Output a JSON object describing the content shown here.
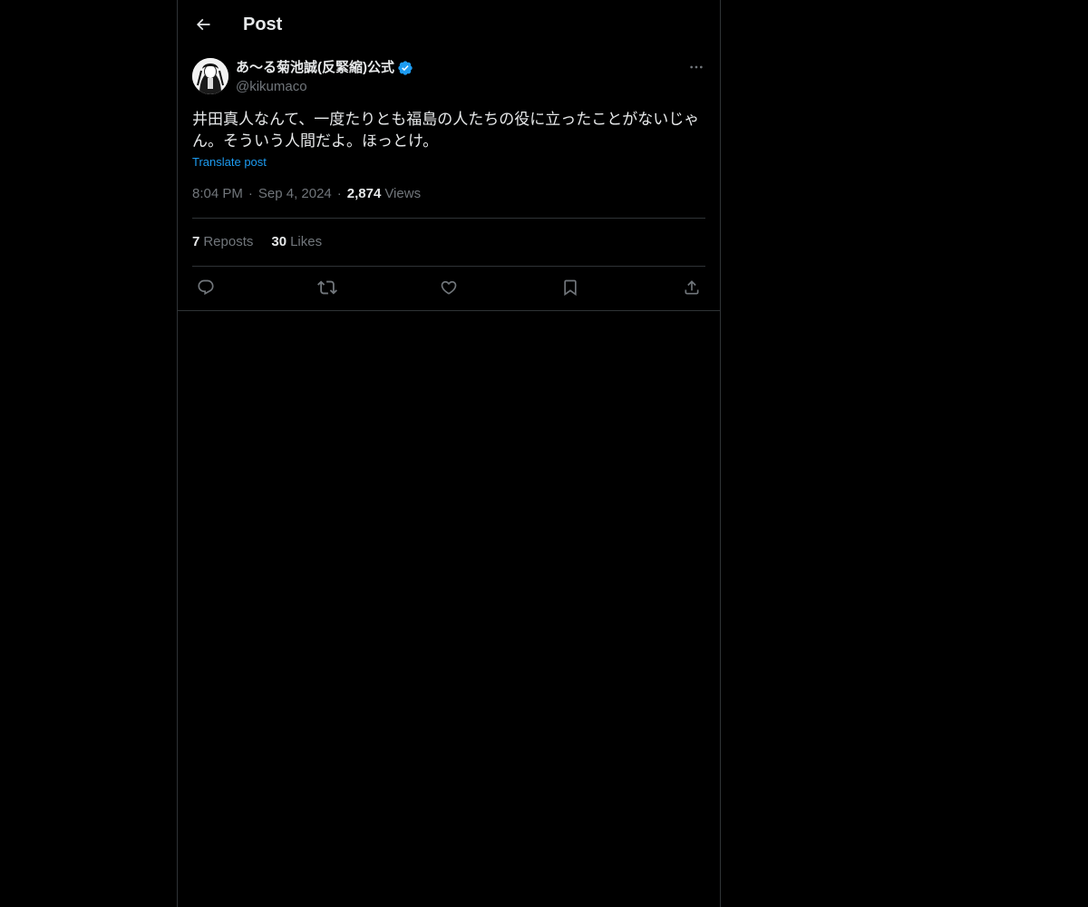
{
  "header": {
    "title": "Post",
    "back_icon": "arrow-left-icon"
  },
  "post": {
    "author": {
      "name": "あ〜る菊池誠(反緊縮)公式",
      "handle": "@kikumaco",
      "verified": true,
      "verified_color": "#1d9bf0"
    },
    "text": "井田真人なんて、一度たりとも福島の人たちの役に立ったことがないじゃん。そういう人間だよ。ほっとけ。",
    "translate_label": "Translate post",
    "time": "8:04 PM",
    "date": "Sep 4, 2024",
    "views_count": "2,874",
    "views_label": "Views",
    "stats": {
      "reposts_count": "7",
      "reposts_label": "Reposts",
      "likes_count": "30",
      "likes_label": "Likes"
    },
    "actions": [
      "reply-icon",
      "repost-icon",
      "like-icon",
      "bookmark-icon",
      "share-icon"
    ]
  },
  "colors": {
    "background": "#000000",
    "text_primary": "#e7e9ea",
    "text_secondary": "#71767b",
    "accent": "#1d9bf0",
    "border": "#2f3336"
  }
}
